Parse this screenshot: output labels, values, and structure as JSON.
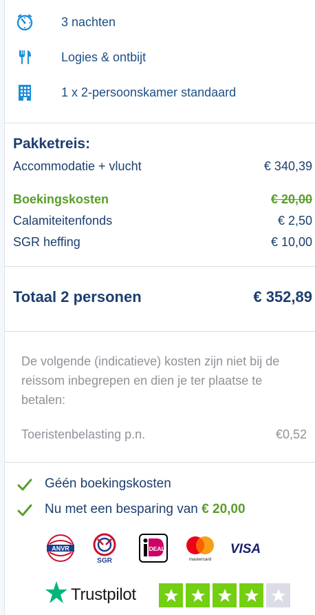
{
  "features": [
    {
      "icon": "timer-icon",
      "label": "3 nachten"
    },
    {
      "icon": "fork-knife-icon",
      "label": "Logies & ontbijt"
    },
    {
      "icon": "building-icon",
      "label": "1 x 2-persoonskamer standaard"
    }
  ],
  "pricing": {
    "title": "Pakketreis:",
    "rows": [
      {
        "label": "Accommodatie + vlucht",
        "value": "€ 340,39"
      },
      {
        "label": "Boekingskosten",
        "value": "€ 20,00",
        "highlight": true,
        "strikethrough": true
      },
      {
        "label": "Calamiteitenfonds",
        "value": "€ 2,50"
      },
      {
        "label": "SGR heffing",
        "value": "€ 10,00"
      }
    ],
    "total_label": "Totaal 2 personen",
    "total_value": "€ 352,89"
  },
  "info": {
    "text": "De volgende (indicatieve) kosten zijn niet bij de reissom inbegrepen en dien je ter plaatse te betalen:",
    "tax_label": "Toeristenbelasting p.n.",
    "tax_value": "€0,52"
  },
  "usps": {
    "item1": "Géén boekingskosten",
    "item2_prefix": "Nu met een besparing van",
    "item2_amount": "€ 20,00"
  },
  "logos": {
    "anvr": "ANVR",
    "sgr": "SGR",
    "ideal": "iDEAL",
    "mastercard": "mastercard",
    "visa": "VISA"
  },
  "trustpilot": {
    "name": "Trustpilot",
    "rating_stars": 4,
    "max_stars": 5
  },
  "colors": {
    "primary": "#1d3e6e",
    "green": "#5a9d2a",
    "muted": "#8e9298",
    "trustpilot_green": "#73cf11"
  }
}
